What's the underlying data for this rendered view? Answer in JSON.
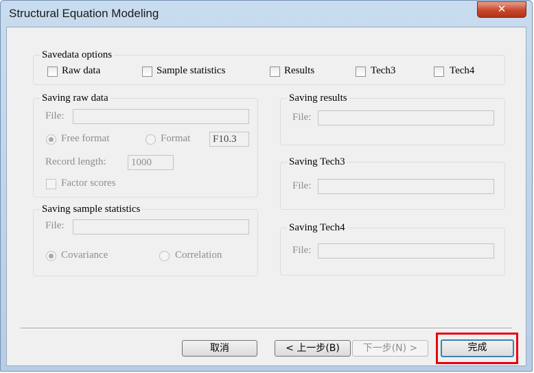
{
  "window": {
    "title": "Structural Equation Modeling",
    "close_label": "✕"
  },
  "savedata": {
    "legend": "Savedata options",
    "options": [
      {
        "label": "Raw data",
        "checked": false
      },
      {
        "label": "Sample statistics",
        "checked": false
      },
      {
        "label": "Results",
        "checked": false
      },
      {
        "label": "Tech3",
        "checked": false
      },
      {
        "label": "Tech4",
        "checked": false
      }
    ]
  },
  "raw": {
    "legend": "Saving raw data",
    "file_label": "File:",
    "file_value": "",
    "free_format_label": "Free format",
    "format_label": "Format",
    "format_value": "F10.3",
    "record_length_label": "Record length:",
    "record_length_value": "1000",
    "factor_scores_label": "Factor scores"
  },
  "sample": {
    "legend": "Saving sample statistics",
    "file_label": "File:",
    "file_value": "",
    "covariance_label": "Covariance",
    "correlation_label": "Correlation"
  },
  "results": {
    "legend": "Saving results",
    "file_label": "File:",
    "file_value": ""
  },
  "tech3": {
    "legend": "Saving Tech3",
    "file_label": "File:",
    "file_value": ""
  },
  "tech4": {
    "legend": "Saving Tech4",
    "file_label": "File:",
    "file_value": ""
  },
  "buttons": {
    "cancel": "取消",
    "back": "< 上一步(B)",
    "next": "下一步(N) >",
    "finish": "完成"
  },
  "colors": {
    "highlight": "#e8000e",
    "close_button": "#c8472b"
  }
}
